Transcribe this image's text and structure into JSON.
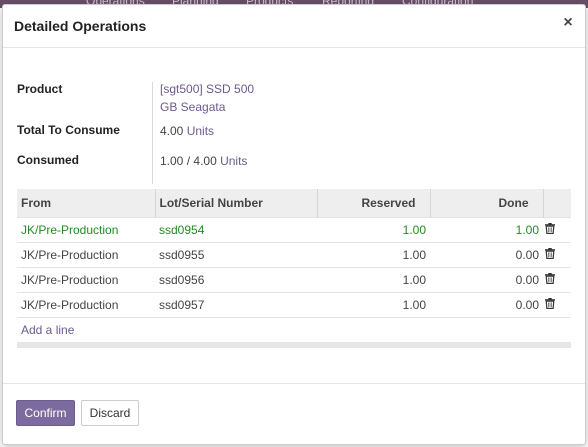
{
  "background_nav": {
    "items": [
      "Operations",
      "Planning",
      "Products",
      "Reporting",
      "Configuration"
    ]
  },
  "modal": {
    "title": "Detailed Operations",
    "close_glyph": "×"
  },
  "form": {
    "product_label": "Product",
    "product_value_line1": "[sgt500] SSD 500",
    "product_value_line2": "GB Seagata",
    "total_label": "Total To Consume",
    "total_qty": "4.00",
    "total_uom": "Units",
    "consumed_label": "Consumed",
    "consumed_qty": "1.00",
    "consumed_sep": "/",
    "consumed_total": "4.00",
    "consumed_uom": "Units"
  },
  "grid": {
    "columns": [
      "From",
      "Lot/Serial Number",
      "Reserved",
      "Done"
    ],
    "rows": [
      {
        "from": "JK/Pre-Production",
        "lot": "ssd0954",
        "reserved": "1.00",
        "done": "1.00",
        "highlight": true
      },
      {
        "from": "JK/Pre-Production",
        "lot": "ssd0955",
        "reserved": "1.00",
        "done": "0.00",
        "highlight": false
      },
      {
        "from": "JK/Pre-Production",
        "lot": "ssd0956",
        "reserved": "1.00",
        "done": "0.00",
        "highlight": false
      },
      {
        "from": "JK/Pre-Production",
        "lot": "ssd0957",
        "reserved": "1.00",
        "done": "0.00",
        "highlight": false
      }
    ],
    "add_line_label": "Add a line",
    "delete_icon": "trash-icon"
  },
  "footer": {
    "confirm_label": "Confirm",
    "discard_label": "Discard"
  },
  "colors": {
    "accent": "#7c6b9e",
    "link": "#6b5a8e",
    "highlight_row": "#228b22",
    "header_bg": "#eeeeee"
  }
}
